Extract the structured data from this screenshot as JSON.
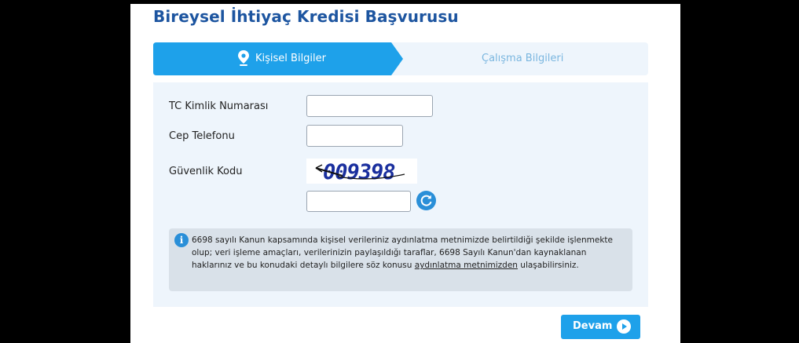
{
  "page": {
    "title": "Bireysel İhtiyaç Kredisi Başvurusu"
  },
  "steps": [
    {
      "label": "Kişisel Bilgiler",
      "active": true,
      "icon": "location-pin-icon"
    },
    {
      "label": "Çalışma Bilgileri",
      "active": false
    }
  ],
  "form": {
    "tc_label": "TC Kimlik Numarası",
    "tc_value": "",
    "phone_label": "Cep Telefonu",
    "phone_value": "",
    "security_label": "Güvenlik Kodu",
    "captcha_text": "009398",
    "captcha_value": ""
  },
  "info": {
    "text_before": "6698 sayılı Kanun kapsamında kişisel verileriniz aydınlatma metnimizde belirtildiği şekilde işlenmekte olup; veri işleme amaçları, verilerinizin paylaşıldığı taraflar, 6698 Sayılı Kanun'dan kaynaklanan haklarınız ve bu konudaki detaylı bilgilere söz konusu ",
    "link_text": "aydınlatma metnimizden",
    "text_after": " ulaşabilirsiniz."
  },
  "actions": {
    "continue_label": "Devam"
  },
  "colors": {
    "primary": "#1ea1ea",
    "title": "#1d55a0",
    "panel": "#eef5fc"
  }
}
